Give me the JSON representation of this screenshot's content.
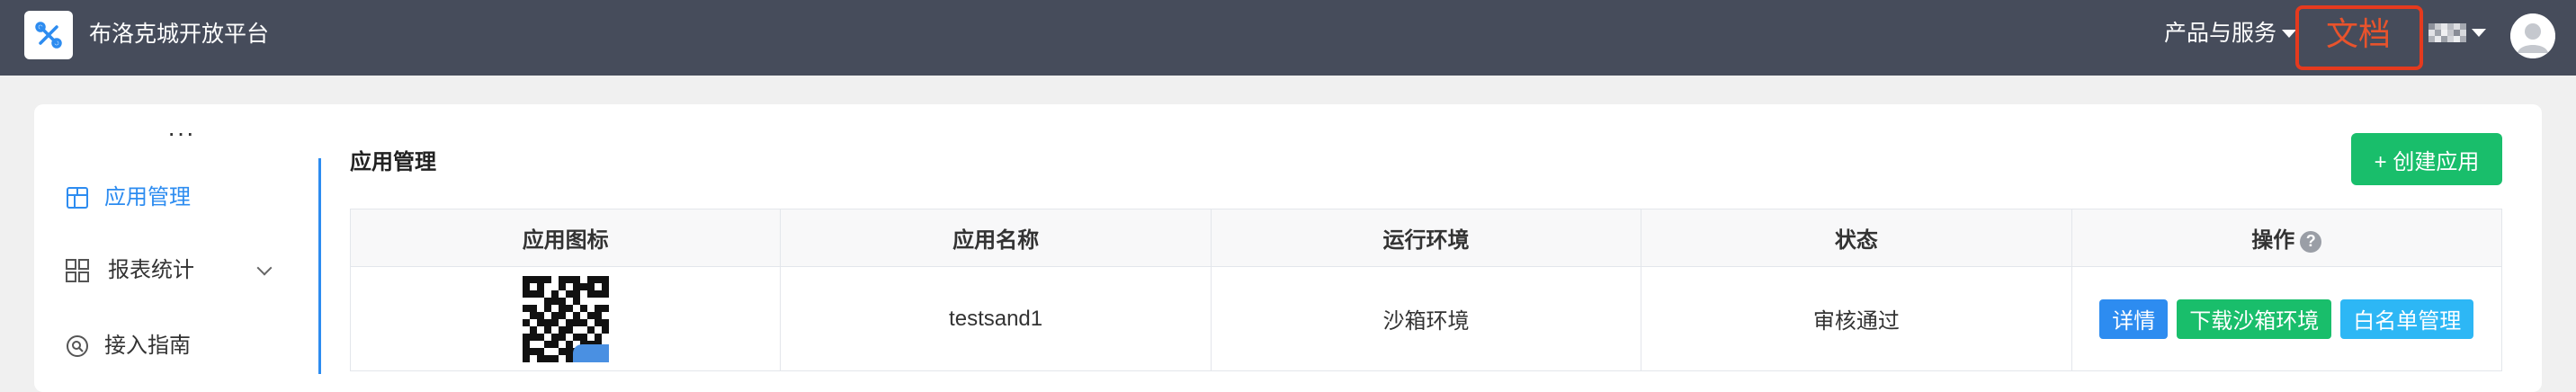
{
  "header": {
    "brand": "布洛克城开放平台",
    "products_label": "产品与服务",
    "docs_label": "文档"
  },
  "sidebar": {
    "more_label": "···",
    "items": [
      {
        "label": "应用管理",
        "icon": "app-grid-icon",
        "active": true
      },
      {
        "label": "报表统计",
        "icon": "report-grid-icon",
        "active": false
      },
      {
        "label": "接入指南",
        "icon": "guide-search-icon",
        "active": false
      }
    ]
  },
  "main": {
    "section_title": "应用管理",
    "create_button": "+ 创建应用",
    "table": {
      "columns": [
        "应用图标",
        "应用名称",
        "运行环境",
        "状态",
        "操作"
      ],
      "rows": [
        {
          "icon": "qr-code-icon",
          "name": "testsand1",
          "environment": "沙箱环境",
          "status": "审核通过",
          "actions": [
            "详情",
            "下载沙箱环境",
            "白名单管理"
          ]
        }
      ]
    }
  },
  "colors": {
    "topbar": "#464c5b",
    "accent_blue": "#2d8cf0",
    "green": "#19be6b",
    "cyan": "#2db7f5",
    "highlight_red": "#e53a1e"
  }
}
